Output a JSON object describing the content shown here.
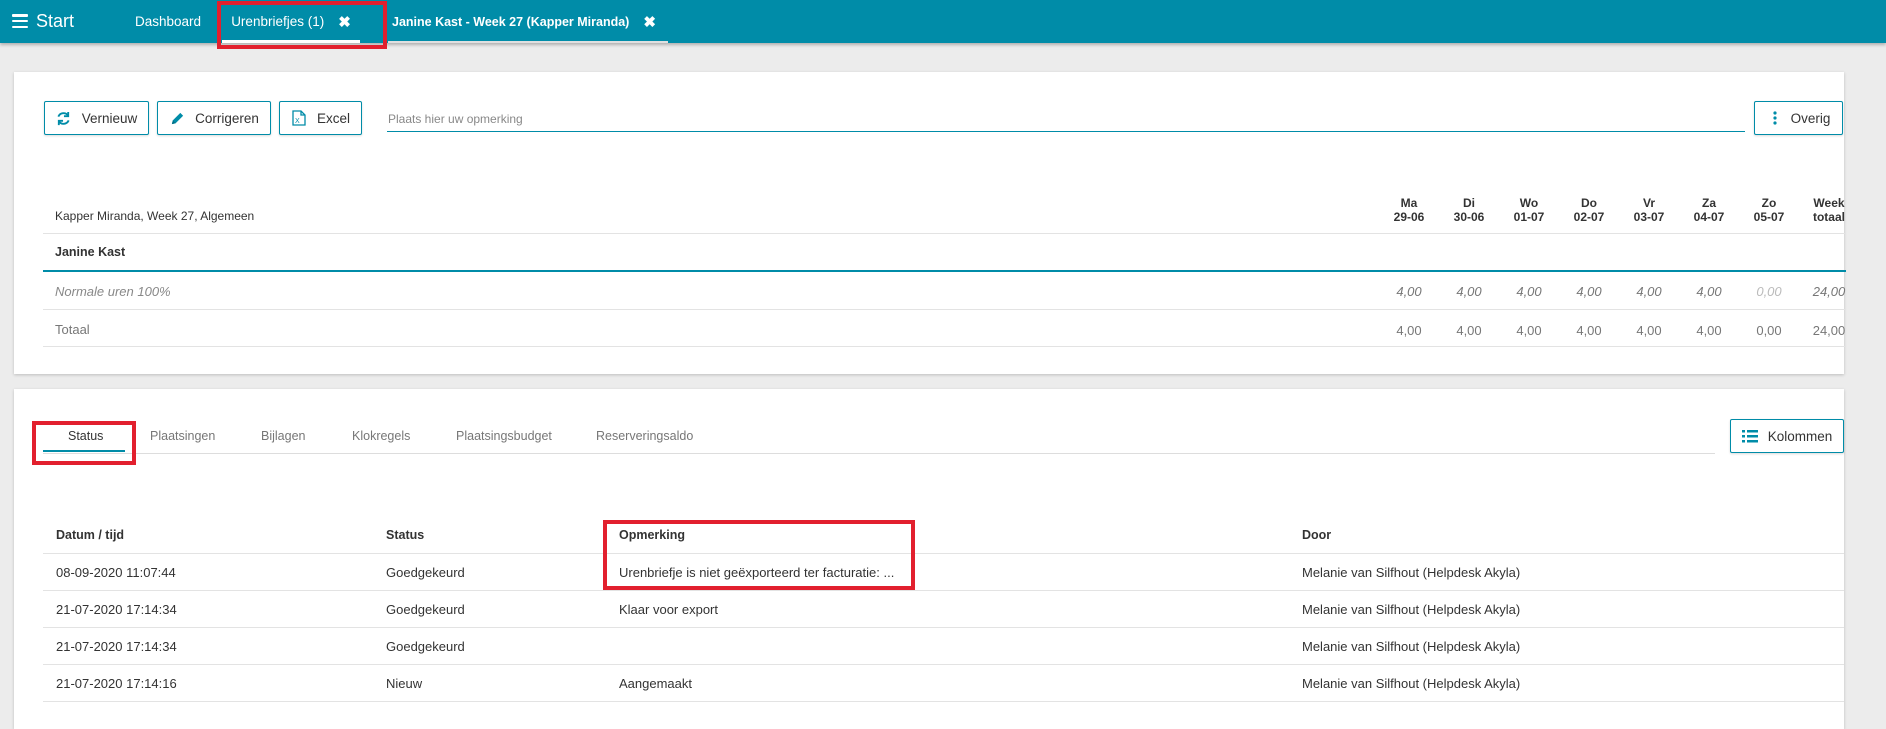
{
  "topbar": {
    "start_label": "Start",
    "tabs": [
      {
        "label": "Dashboard"
      },
      {
        "label": "Urenbriefjes (1)",
        "close": "✖"
      },
      {
        "label": "Janine Kast - Week 27 (Kapper Miranda)",
        "close": "✖"
      }
    ]
  },
  "toolbar": {
    "refresh_label": "Vernieuw",
    "correct_label": "Corrigeren",
    "excel_label": "Excel",
    "remark_placeholder": "Plaats hier uw opmerking",
    "other_label": "Overig"
  },
  "hours": {
    "title": "Kapper Miranda, Week 27, Algemeen",
    "days": [
      {
        "name": "Ma",
        "date": "29-06"
      },
      {
        "name": "Di",
        "date": "30-06"
      },
      {
        "name": "Wo",
        "date": "01-07"
      },
      {
        "name": "Do",
        "date": "02-07"
      },
      {
        "name": "Vr",
        "date": "03-07"
      },
      {
        "name": "Za",
        "date": "04-07"
      },
      {
        "name": "Zo",
        "date": "05-07"
      }
    ],
    "week_total_head": [
      "Week",
      "totaal"
    ],
    "employee": "Janine Kast",
    "rows": [
      {
        "label": "Normale uren 100%",
        "values": [
          "4,00",
          "4,00",
          "4,00",
          "4,00",
          "4,00",
          "4,00",
          "0,00"
        ],
        "total": "24,00"
      },
      {
        "label": "Totaal",
        "values": [
          "4,00",
          "4,00",
          "4,00",
          "4,00",
          "4,00",
          "4,00",
          "0,00"
        ],
        "total": "24,00"
      }
    ]
  },
  "details": {
    "tabs": [
      "Status",
      "Plaatsingen",
      "Bijlagen",
      "Klokregels",
      "Plaatsingsbudget",
      "Reserveringsaldo"
    ],
    "columns_label": "Kolommen",
    "headers": [
      "Datum / tijd",
      "Status",
      "Opmerking",
      "Door"
    ],
    "rows": [
      [
        "08-09-2020 11:07:44",
        "Goedgekeurd",
        "Urenbriefje is niet geëxporteerd ter facturatie: ...",
        "Melanie van Silfhout (Helpdesk Akyla)"
      ],
      [
        "21-07-2020 17:14:34",
        "Goedgekeurd",
        "Klaar voor export",
        "Melanie van Silfhout (Helpdesk Akyla)"
      ],
      [
        "21-07-2020 17:14:34",
        "Goedgekeurd",
        "",
        "Melanie van Silfhout (Helpdesk Akyla)"
      ],
      [
        "21-07-2020 17:14:16",
        "Nieuw",
        "Aangemaakt",
        "Melanie van Silfhout (Helpdesk Akyla)"
      ]
    ]
  },
  "colors": {
    "accent": "#008ca8",
    "highlight": "#e2202e"
  },
  "icons": [
    "menu-icon",
    "close-icon",
    "refresh-icon",
    "pencil-icon",
    "excel-icon",
    "more-vertical-icon",
    "list-icon"
  ]
}
